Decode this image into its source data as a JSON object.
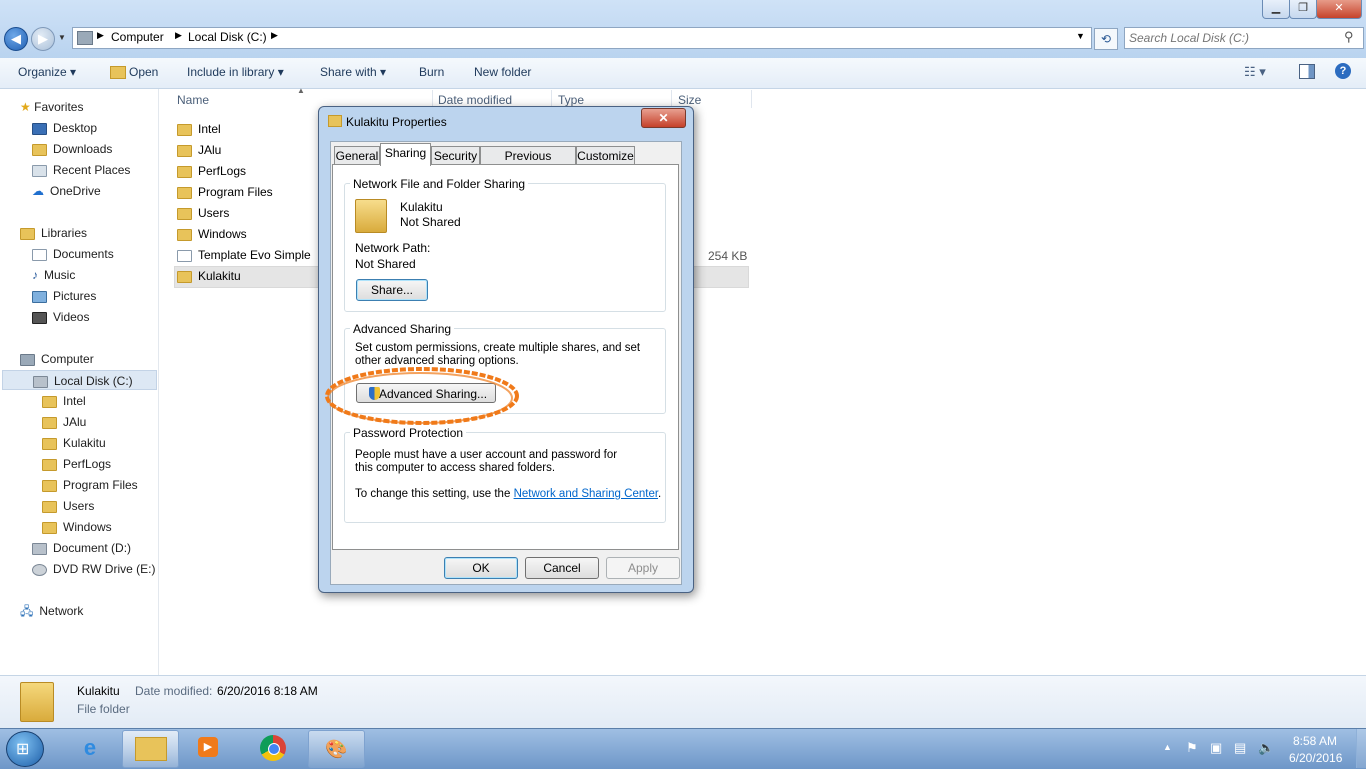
{
  "explorer": {
    "address": {
      "crumbs": [
        "Computer",
        "Local Disk (C:)"
      ]
    },
    "search": {
      "placeholder": "Search Local Disk (C:)"
    },
    "commands": {
      "organize": "Organize",
      "open": "Open",
      "include": "Include in library",
      "share": "Share with",
      "burn": "Burn",
      "new_folder": "New folder"
    },
    "nav": {
      "favorites": "Favorites",
      "desktop": "Desktop",
      "downloads": "Downloads",
      "recent": "Recent Places",
      "onedrive": "OneDrive",
      "libraries": "Libraries",
      "documents": "Documents",
      "music": "Music",
      "pictures": "Pictures",
      "videos": "Videos",
      "computer": "Computer",
      "local_disk": "Local Disk (C:)",
      "sub": [
        "Intel",
        "JAlu",
        "Kulakitu",
        "PerfLogs",
        "Program Files",
        "Users",
        "Windows"
      ],
      "doc_d": "Document (D:)",
      "dvd": "DVD RW Drive (E:) T",
      "network": "Network"
    },
    "columns": {
      "name": "Name",
      "date": "Date modified",
      "type": "Type",
      "size": "Size"
    },
    "files": [
      "Intel",
      "JAlu",
      "PerfLogs",
      "Program Files",
      "Users",
      "Windows",
      "Template Evo Simple",
      "Kulakitu"
    ],
    "template_size": "254 KB",
    "details": {
      "name": "Kulakitu",
      "date_label": "Date modified:",
      "date_value": "6/20/2016 8:18 AM",
      "type": "File folder"
    }
  },
  "dialog": {
    "title": "Kulakitu Properties",
    "tabs": [
      "General",
      "Sharing",
      "Security",
      "Previous Versions",
      "Customize"
    ],
    "network_sharing": {
      "header": "Network File and Folder Sharing",
      "folder_name": "Kulakitu",
      "status": "Not Shared",
      "path_label": "Network Path:",
      "path_value": "Not Shared",
      "share_button": "Share..."
    },
    "advanced": {
      "header": "Advanced Sharing",
      "description": "Set custom permissions, create multiple shares, and set other advanced sharing options.",
      "button": "Advanced Sharing..."
    },
    "password": {
      "header": "Password Protection",
      "text": "People must have a user account and password for this computer to access shared folders.",
      "change_prefix": "To change this setting, use the",
      "link": "Network and Sharing Center",
      "suffix": "."
    },
    "buttons": {
      "ok": "OK",
      "cancel": "Cancel",
      "apply": "Apply"
    }
  },
  "taskbar": {
    "time": "8:58 AM",
    "date": "6/20/2016"
  },
  "colors": {
    "highlight_circle": "#f07a1a",
    "link": "#0066cc",
    "accent": "#1e395b"
  }
}
